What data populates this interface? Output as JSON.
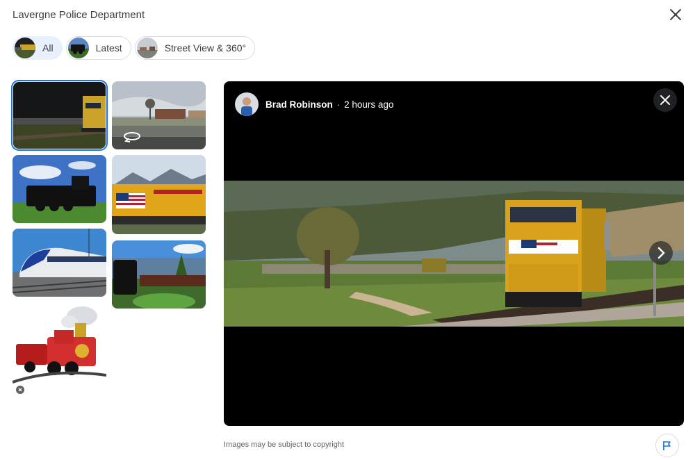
{
  "header": {
    "title": "Lavergne Police Department"
  },
  "filters": [
    {
      "label": "All",
      "active": true
    },
    {
      "label": "Latest",
      "active": false
    },
    {
      "label": "Street View & 360°",
      "active": false
    }
  ],
  "photos": [
    {
      "name": "freight-train-dusk",
      "selected": true
    },
    {
      "name": "street-view-parking-lot",
      "type": "360"
    },
    {
      "name": "steam-locomotive"
    },
    {
      "name": "union-pacific-flag-locomotive"
    },
    {
      "name": "high-speed-train"
    },
    {
      "name": "steam-train-mountains"
    },
    {
      "name": "toy-train-illustration"
    }
  ],
  "viewer": {
    "author": "Brad Robinson",
    "separator": "·",
    "time": "2 hours ago"
  },
  "footer": {
    "copyright": "Images may be subject to copyright"
  },
  "colors": {
    "accent": "#1a73e8",
    "chip_active": "#e8f0fe",
    "viewer_bg": "#000000"
  }
}
